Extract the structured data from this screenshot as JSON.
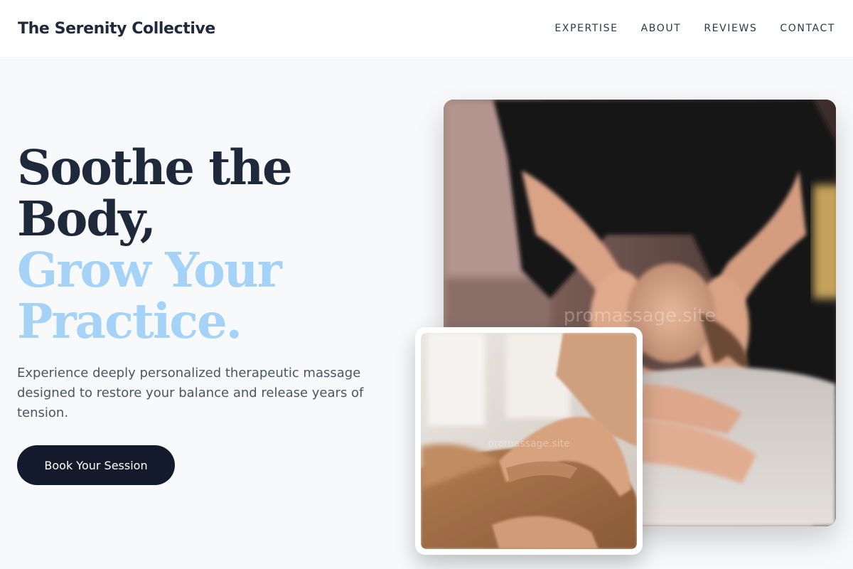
{
  "header": {
    "brand": "The Serenity Collective",
    "nav": [
      {
        "label": "EXPERTISE"
      },
      {
        "label": "ABOUT"
      },
      {
        "label": "REVIEWS"
      },
      {
        "label": "CONTACT"
      }
    ]
  },
  "hero": {
    "heading_line1": "Soothe the",
    "heading_line2": "Body,",
    "heading_line3": "Grow Your",
    "heading_line4": "Practice.",
    "subtext": "Experience deeply personalized therapeutic massage designed to restore your balance and release years of tension.",
    "cta_label": "Book Your Session"
  },
  "images": {
    "main_watermark": "promassage.site",
    "inset_watermark": "promassage.site"
  },
  "colors": {
    "heading_dark": "#1e293b",
    "heading_accent": "#a5d3f7",
    "cta_bg": "#131a2b",
    "page_bg": "#f7f9fb"
  }
}
